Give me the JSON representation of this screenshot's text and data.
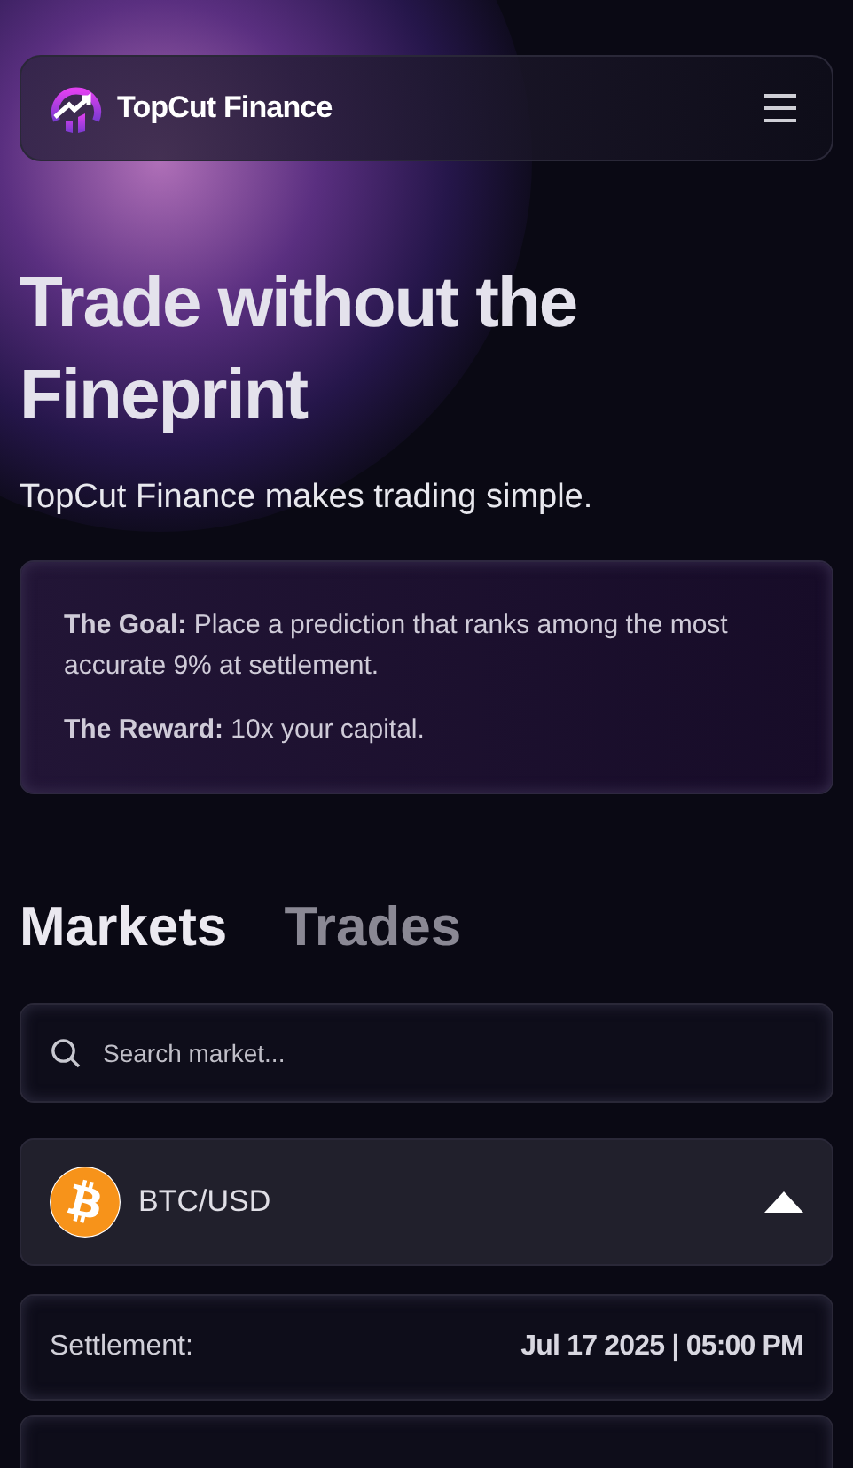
{
  "navbar": {
    "brand": "TopCut Finance"
  },
  "hero": {
    "title": "Trade without the Fineprint",
    "subtitle": "TopCut Finance makes trading simple."
  },
  "info_card": {
    "lines": [
      "**The Goal:** Place a prediction that ranks among the most accurate 9% at settlement.",
      "**The Reward:** 10x your capital."
    ]
  },
  "tabs": [
    {
      "label": "Markets",
      "selected": true
    },
    {
      "label": "Trades",
      "selected": false
    }
  ],
  "search": {
    "placeholder": "Search market..."
  },
  "market": {
    "name": "BTC/USD",
    "expanded": true
  },
  "details": [
    {
      "label": "Settlement:",
      "value": "Jul 17 2025 | 05:00 PM"
    }
  ]
}
